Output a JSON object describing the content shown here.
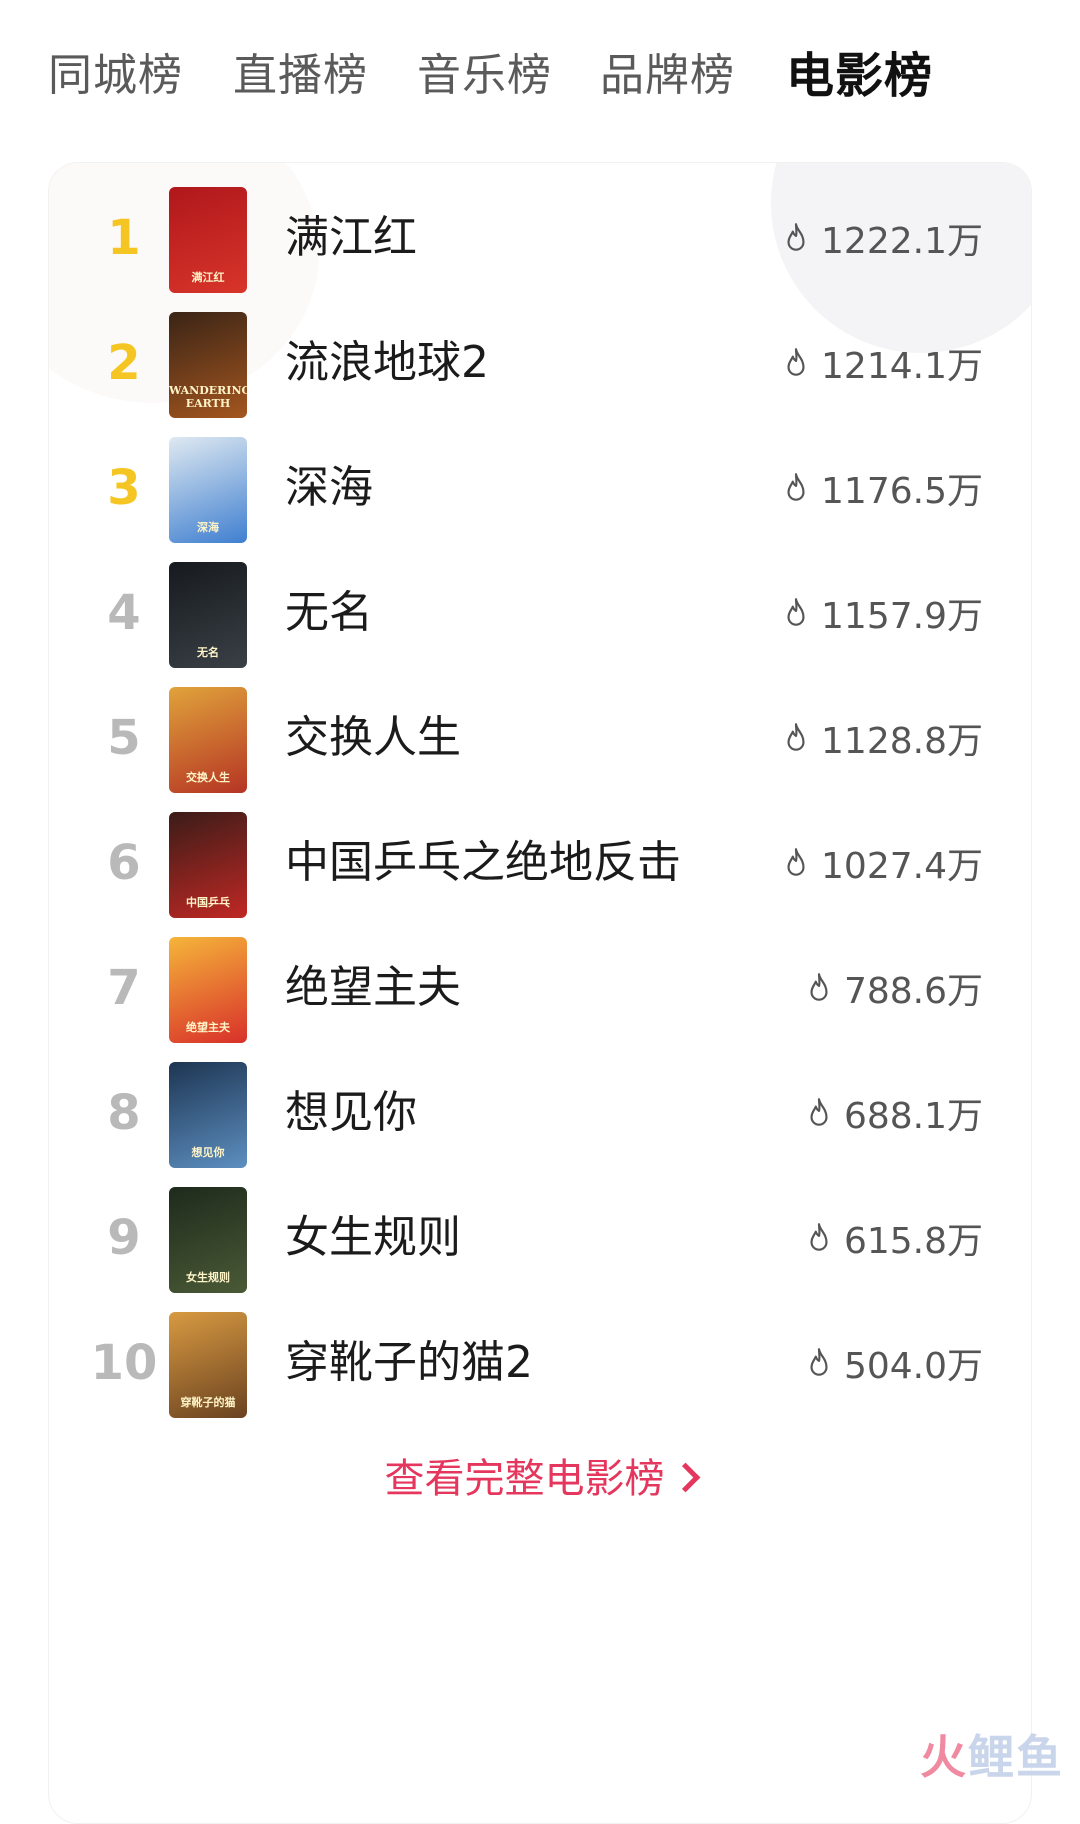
{
  "tabs": [
    {
      "label": "同城榜"
    },
    {
      "label": "直播榜"
    },
    {
      "label": "音乐榜"
    },
    {
      "label": "品牌榜"
    },
    {
      "label": "电影榜"
    }
  ],
  "active_tab": "电影榜",
  "movies": [
    {
      "rank": "1",
      "title": "满江红",
      "heat": "1222.1万",
      "poster_text": "满江红",
      "poster_colors": [
        "#b0171b",
        "#d8352a"
      ]
    },
    {
      "rank": "2",
      "title": "流浪地球2",
      "heat": "1214.1万",
      "poster_text": "WANDERING EARTH",
      "poster_colors": [
        "#3a2416",
        "#a4561f"
      ]
    },
    {
      "rank": "3",
      "title": "深海",
      "heat": "1176.5万",
      "poster_text": "深海",
      "poster_colors": [
        "#dfe9f1",
        "#3f7fd0"
      ]
    },
    {
      "rank": "4",
      "title": "无名",
      "heat": "1157.9万",
      "poster_text": "无名",
      "poster_colors": [
        "#161a1e",
        "#3a4046"
      ]
    },
    {
      "rank": "5",
      "title": "交换人生",
      "heat": "1128.8万",
      "poster_text": "交换人生",
      "poster_colors": [
        "#e0a33b",
        "#b53424"
      ]
    },
    {
      "rank": "6",
      "title": "中国乒乓之绝地反击",
      "heat": "1027.4万",
      "poster_text": "中国乒乓",
      "poster_colors": [
        "#3b1c18",
        "#c02824"
      ]
    },
    {
      "rank": "7",
      "title": "绝望主夫",
      "heat": "788.6万",
      "poster_text": "绝望主夫",
      "poster_colors": [
        "#f5b53a",
        "#d8302a"
      ]
    },
    {
      "rank": "8",
      "title": "想见你",
      "heat": "688.1万",
      "poster_text": "想见你",
      "poster_colors": [
        "#1d3552",
        "#5d8fc0"
      ]
    },
    {
      "rank": "9",
      "title": "女生规则",
      "heat": "615.8万",
      "poster_text": "女生规则",
      "poster_colors": [
        "#1e2a1c",
        "#4a5a36"
      ]
    },
    {
      "rank": "10",
      "title": "穿靴子的猫2",
      "heat": "504.0万",
      "poster_text": "穿靴子的猫",
      "poster_colors": [
        "#d89a42",
        "#6a4220"
      ]
    }
  ],
  "more_label": "查看完整电影榜",
  "watermark": {
    "part1": "火",
    "part2": "鲤鱼"
  },
  "colors": {
    "accent": "#e5375d",
    "top_rank": "#f5c623",
    "rank": "#b9b9b9"
  },
  "icons": {
    "heat": "fire-icon",
    "more": "chevron-right-icon"
  }
}
